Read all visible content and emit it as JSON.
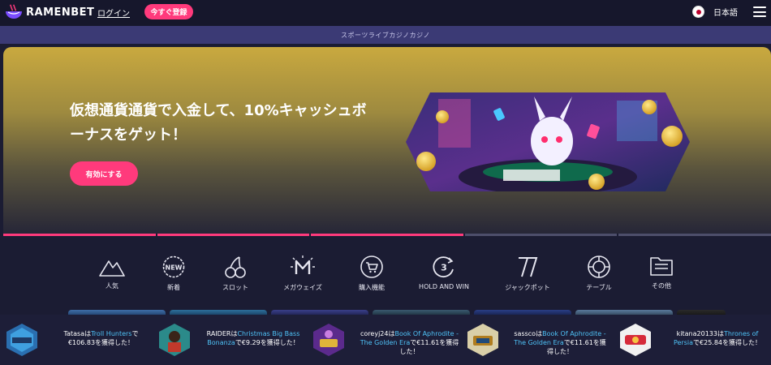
{
  "header": {
    "brand": "RAMENBET",
    "login_label": "ログイン",
    "register_label": "今すぐ登録",
    "language": "日本語"
  },
  "subnav": {
    "text": "スポーツライブカジノカジノ"
  },
  "hero": {
    "title": "仮想通貨通貨で入金して、10%キャッシュボーナスをゲット！",
    "cta_label": "有効にする",
    "slides_total": 5,
    "slides_active": [
      1,
      2,
      3
    ]
  },
  "categories": [
    {
      "label": "人気",
      "icon": "mountain-icon"
    },
    {
      "label": "新着",
      "icon": "new-badge-icon"
    },
    {
      "label": "スロット",
      "icon": "cherries-icon"
    },
    {
      "label": "メガウェイズ",
      "icon": "megaways-icon"
    },
    {
      "label": "購入機能",
      "icon": "shopping-cart-icon"
    },
    {
      "label": "HOLD AND WIN",
      "icon": "hold-and-win-icon"
    },
    {
      "label": "ジャックポット",
      "icon": "seven-icon"
    },
    {
      "label": "テーブル",
      "icon": "poker-chip-icon"
    },
    {
      "label": "その他",
      "icon": "folder-icon"
    }
  ],
  "winners": [
    {
      "user": "Tatasa",
      "pre": "は",
      "game": "Troll Hunters",
      "post": "で€106.83を獲得した！"
    },
    {
      "user": "RAIDER",
      "pre": "は",
      "game": "Christmas Big Bass Bonanza",
      "post": "で€9.29を獲得した！"
    },
    {
      "user": "coreyj24",
      "pre": "は",
      "game": "Book Of Aphrodite - The Golden Era",
      "post": "で€11.61を獲得した！"
    },
    {
      "user": "sassco",
      "pre": "は",
      "game": "Book Of Aphrodite - The Golden Era",
      "post": "で€11.61を獲得した！"
    },
    {
      "user": "kitana20133",
      "pre": "は",
      "game": "Thrones of Persia",
      "post": "で€25.84を獲得した！"
    }
  ],
  "colors": {
    "accent": "#ff3a7c",
    "header_bg": "#16172c",
    "subnav_bg": "#3b3a75",
    "page_bg": "#1b1c33",
    "link": "#4fc3f7"
  }
}
